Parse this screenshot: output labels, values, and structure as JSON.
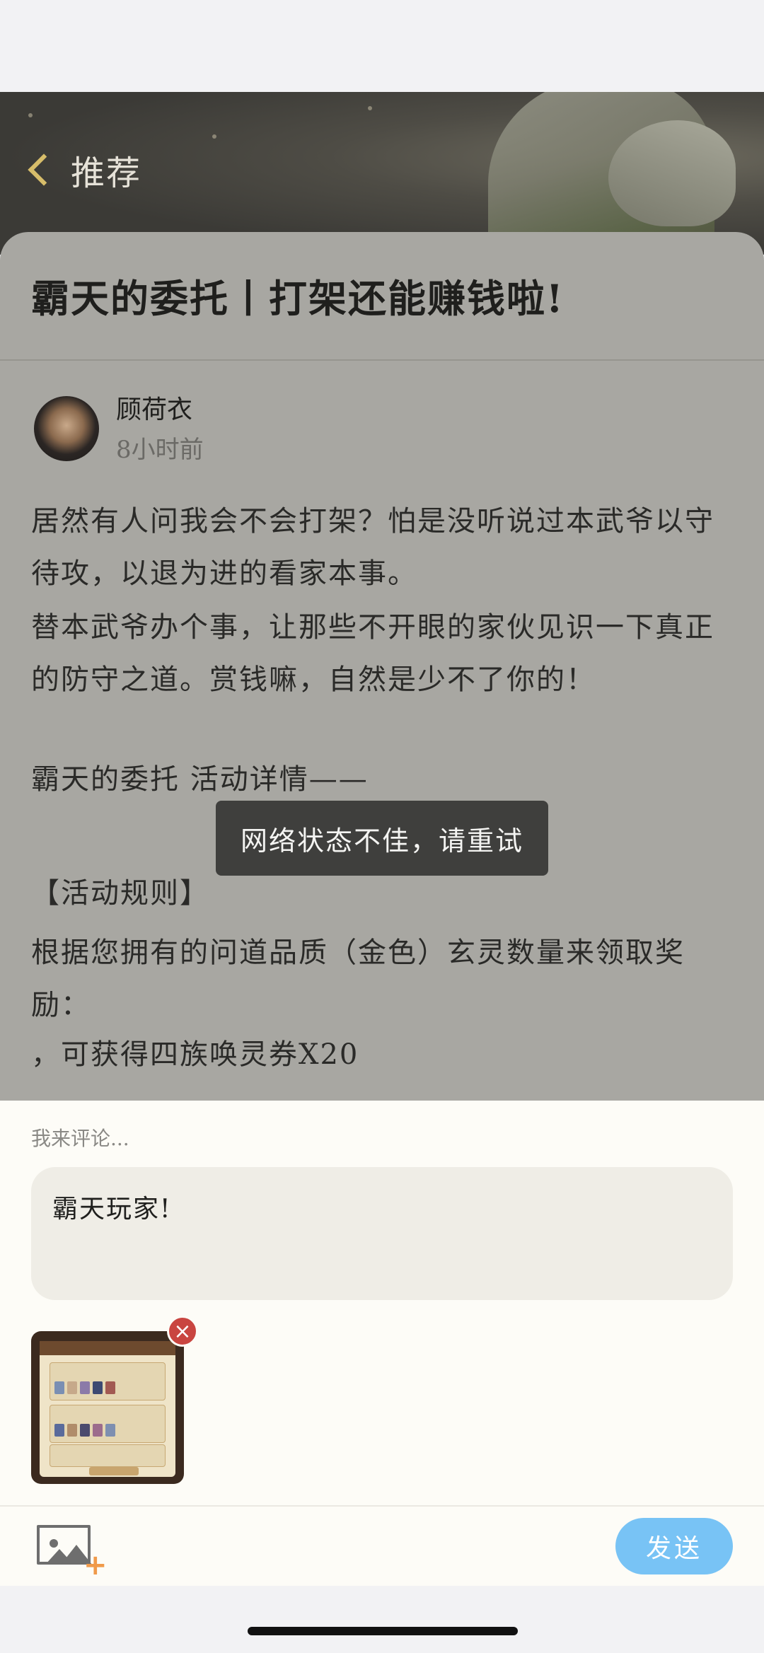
{
  "header": {
    "back_label": "推荐"
  },
  "article": {
    "title": "霸天的委托丨打架还能赚钱啦!",
    "author": {
      "name": "顾荷衣",
      "time": "8小时前"
    },
    "paragraphs": [
      "居然有人问我会不会打架？怕是没听说过本武爷以守待攻，以退为进的看家本事。",
      "替本武爷办个事，让那些不开眼的家伙见识一下真正的防守之道。赏钱嘛，自然是少不了你的！",
      "霸天的委托 活动详情——",
      "【活动规则】",
      "根据您拥有的问道品质（金色）玄灵数量来领取奖励：",
      "，可获得四族唤灵券X20"
    ]
  },
  "toast": {
    "message": "网络状态不佳，请重试"
  },
  "comment": {
    "hint": "我来评论...",
    "text": "霸天玩家!",
    "send_label": "发送"
  },
  "icons": {
    "back": "chevron-left-icon",
    "image": "image-add-icon",
    "remove": "close-icon"
  },
  "colors": {
    "send_button": "#78c3f5",
    "remove_badge": "#c94540",
    "accent_chevron": "#d7bd6a"
  }
}
